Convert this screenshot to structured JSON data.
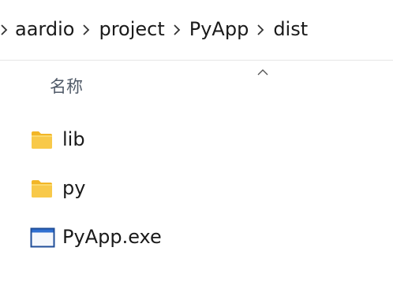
{
  "breadcrumb": {
    "items": [
      {
        "label": "aardio"
      },
      {
        "label": "project"
      },
      {
        "label": "PyApp"
      },
      {
        "label": "dist"
      }
    ]
  },
  "file_list": {
    "column_header": "名称",
    "sort_direction": "ascending",
    "files": [
      {
        "name": "lib",
        "icon": "folder-icon"
      },
      {
        "name": "py",
        "icon": "folder-icon"
      },
      {
        "name": "PyApp.exe",
        "icon": "application-window-icon"
      }
    ]
  },
  "colors": {
    "folder_body": "#f8c94a",
    "folder_tab": "#f2b627",
    "app_icon_border": "#1f4e99",
    "app_icon_titlebar": "#2f6fd1",
    "divider": "#e5e5e5",
    "header_text": "#505a68"
  }
}
